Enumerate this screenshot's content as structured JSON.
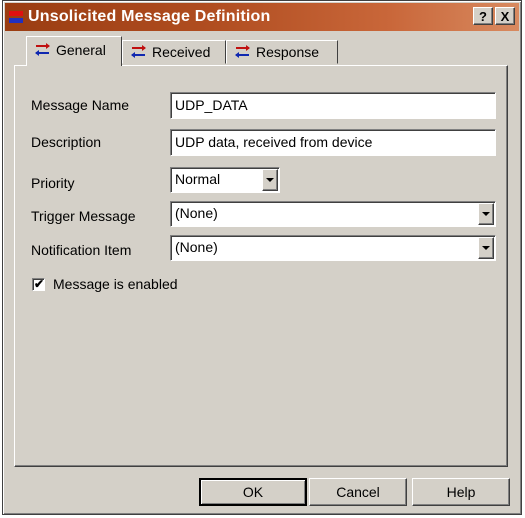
{
  "window": {
    "title": "Unsolicited Message Definition",
    "help_button": "?",
    "close_button": "X",
    "title_gradient_start": "#9a3d12",
    "title_gradient_end": "#d88a60"
  },
  "tabs": [
    {
      "label": "General",
      "active": true,
      "icon": "exchange-arrows-icon"
    },
    {
      "label": "Received",
      "active": false,
      "icon": "exchange-arrows-icon"
    },
    {
      "label": "Response",
      "active": false,
      "icon": "exchange-arrows-icon"
    }
  ],
  "form": {
    "message_name": {
      "label": "Message Name",
      "value": "UDP_DATA"
    },
    "description": {
      "label": "Description",
      "value": "UDP data, received from device"
    },
    "priority": {
      "label": "Priority",
      "value": "Normal"
    },
    "trigger_message": {
      "label": "Trigger Message",
      "value": "(None)"
    },
    "notification_item": {
      "label": "Notification Item",
      "value": "(None)"
    },
    "enabled": {
      "label": "Message is enabled",
      "checked": true
    }
  },
  "buttons": {
    "ok": "OK",
    "cancel": "Cancel",
    "help": "Help"
  }
}
